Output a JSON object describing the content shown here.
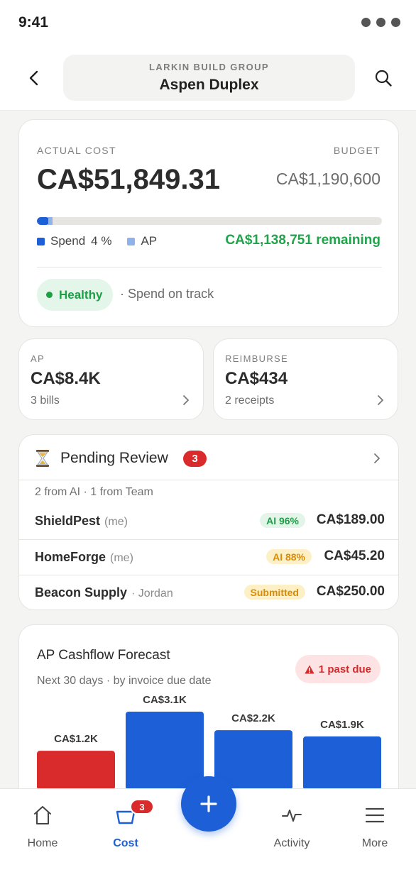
{
  "status_bar": {
    "time": "9:41"
  },
  "header": {
    "company": "LARKIN BUILD GROUP",
    "project": "Aspen Duplex"
  },
  "cost_summary": {
    "actual_label": "ACTUAL COST",
    "actual_value": "CA$51,849.31",
    "budget_label": "BUDGET",
    "budget_value": "CA$1,190,600",
    "spend_fraction": 0.04,
    "ap_fraction": 0.007,
    "legend_spend": "Spend",
    "legend_spend_pct": "4 %",
    "legend_ap": "AP",
    "remaining": "CA$1,138,751 remaining",
    "health_status": "Healthy",
    "health_note": "· Spend on track",
    "colors": {
      "spend": "#1d5fd6",
      "ap": "#8fb2ea",
      "healthy": "#1f9e48"
    }
  },
  "ap_card": {
    "label": "AP",
    "value": "CA$8.4K",
    "sub": "3 bills"
  },
  "reimburse_card": {
    "label": "REIMBURSE",
    "value": "CA$434",
    "sub": "2 receipts"
  },
  "pending": {
    "title": "Pending Review",
    "count": "3",
    "summary": "2 from AI · 1 from Team",
    "rows": [
      {
        "vendor": "ShieldPest",
        "tag": "(me)",
        "badge": "AI 96%",
        "badge_style": "green",
        "amount": "CA$189.00"
      },
      {
        "vendor": "HomeForge",
        "tag": "(me)",
        "badge": "AI 88%",
        "badge_style": "yellow",
        "amount": "CA$45.20"
      },
      {
        "vendor": "Beacon Supply",
        "tag": "· Jordan",
        "badge": "Submitted",
        "badge_style": "yellow",
        "amount": "CA$250.00"
      }
    ]
  },
  "forecast": {
    "title": "AP Cashflow Forecast",
    "subtitle": "Next 30 days · by invoice due date",
    "past_due": "1 past due"
  },
  "chart_data": {
    "type": "bar",
    "title": "AP Cashflow Forecast",
    "values": [
      1.2,
      3.1,
      2.2,
      1.9
    ],
    "data_labels": [
      "CA$1.2K",
      "CA$3.1K",
      "CA$2.2K",
      "CA$1.9K"
    ],
    "colors": [
      "#d92b2b",
      "#1d5fd6",
      "#1d5fd6",
      "#1d5fd6"
    ],
    "ylim": [
      0,
      3.1
    ]
  },
  "tabbar": {
    "home": "Home",
    "cost": "Cost",
    "cost_badge": "3",
    "activity": "Activity",
    "more": "More"
  }
}
